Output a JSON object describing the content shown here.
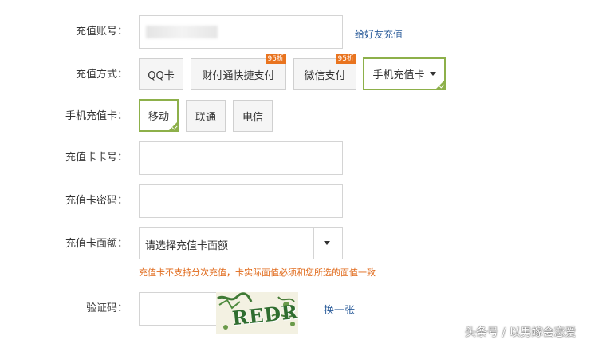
{
  "account": {
    "label": "充值账号：",
    "friend_link": "给好友充值"
  },
  "payment": {
    "label": "充值方式：",
    "options": [
      {
        "label": "QQ卡",
        "badge": ""
      },
      {
        "label": "财付通快捷支付",
        "badge": "95折"
      },
      {
        "label": "微信支付",
        "badge": "95折"
      },
      {
        "label": "手机充值卡",
        "badge": ""
      }
    ],
    "selected": "手机充值卡"
  },
  "carrier": {
    "label": "手机充值卡：",
    "options": [
      "移动",
      "联通",
      "电信"
    ],
    "selected": "移动"
  },
  "card_number": {
    "label": "充值卡卡号："
  },
  "card_password": {
    "label": "充值卡密码："
  },
  "card_value": {
    "label": "充值卡面额：",
    "selected": "请选择充值卡面额",
    "hint": "充值卡不支持分次充值，卡实际面值必须和您所选的面值一致"
  },
  "captcha": {
    "label": "验证码：",
    "image_text": "REDR",
    "refresh_link": "换一张"
  },
  "watermark": "头条号 / 以男嫁会恋爱",
  "colors": {
    "accent": "#8db04a",
    "badge": "#e9741f",
    "link": "#2b5c9a",
    "hint": "#e06a1b"
  }
}
